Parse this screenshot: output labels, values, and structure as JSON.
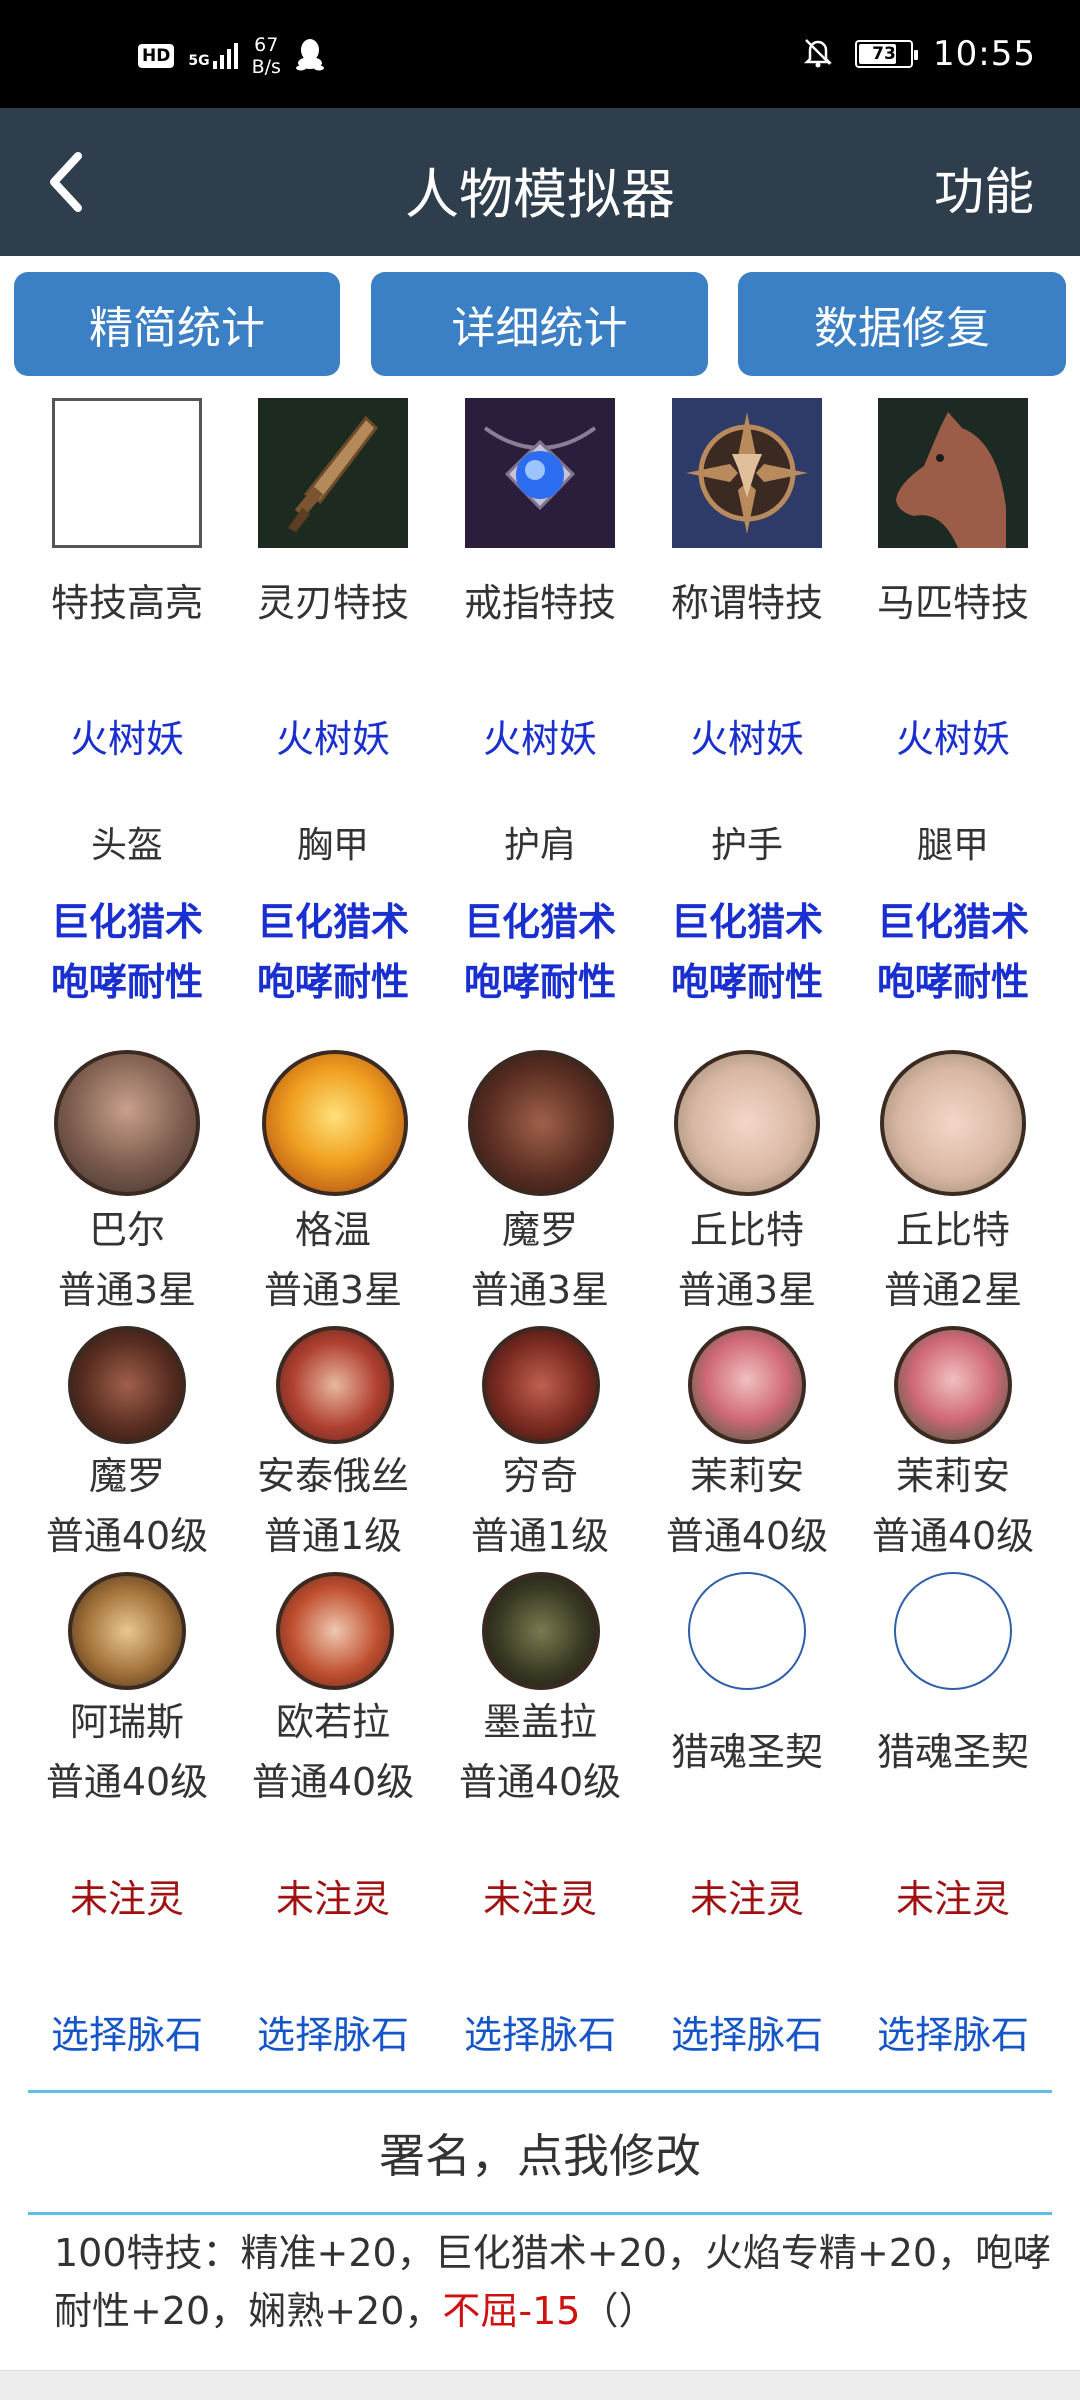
{
  "status_bar": {
    "hd": "HD",
    "network": "5G",
    "speed_value": "67",
    "speed_unit": "B/s",
    "battery": "73",
    "battery_level": 0.73,
    "time": "10:55"
  },
  "app_bar": {
    "title": "人物模拟器",
    "function_label": "功能"
  },
  "top_buttons": [
    "精简统计",
    "详细统计",
    "数据修复"
  ],
  "skills": [
    {
      "label": "特技高亮",
      "icon": "empty-box-icon"
    },
    {
      "label": "灵刃特技",
      "icon": "dagger-icon"
    },
    {
      "label": "戒指特技",
      "icon": "ring-amulet-icon"
    },
    {
      "label": "称谓特技",
      "icon": "emblem-icon"
    },
    {
      "label": "马匹特技",
      "icon": "horse-icon"
    }
  ],
  "set_name": [
    "火树妖",
    "火树妖",
    "火树妖",
    "火树妖",
    "火树妖"
  ],
  "armor": [
    {
      "slot": "头盔",
      "attr1": "巨化猎术",
      "attr2": "咆哮耐性"
    },
    {
      "slot": "胸甲",
      "attr1": "巨化猎术",
      "attr2": "咆哮耐性"
    },
    {
      "slot": "护肩",
      "attr1": "巨化猎术",
      "attr2": "咆哮耐性"
    },
    {
      "slot": "护手",
      "attr1": "巨化猎术",
      "attr2": "咆哮耐性"
    },
    {
      "slot": "腿甲",
      "attr1": "巨化猎术",
      "attr2": "咆哮耐性"
    }
  ],
  "heroes_row1": [
    {
      "name": "巴尔",
      "level": "普通3星"
    },
    {
      "name": "格温",
      "level": "普通3星"
    },
    {
      "name": "魔罗",
      "level": "普通3星"
    },
    {
      "name": "丘比特",
      "level": "普通3星"
    },
    {
      "name": "丘比特",
      "level": "普通2星"
    }
  ],
  "heroes_row2": [
    {
      "name": "魔罗",
      "level": "普通40级"
    },
    {
      "name": "安泰俄丝",
      "level": "普通1级"
    },
    {
      "name": "穷奇",
      "level": "普通1级"
    },
    {
      "name": "茉莉安",
      "level": "普通40级"
    },
    {
      "name": "茉莉安",
      "level": "普通40级"
    }
  ],
  "heroes_row3": [
    {
      "name": "阿瑞斯",
      "level": "普通40级"
    },
    {
      "name": "欧若拉",
      "level": "普通40级"
    },
    {
      "name": "墨盖拉",
      "level": "普通40级"
    },
    {
      "name": "猎魂圣契",
      "level": ""
    },
    {
      "name": "猎魂圣契",
      "level": ""
    }
  ],
  "spirit": [
    "未注灵",
    "未注灵",
    "未注灵",
    "未注灵",
    "未注灵"
  ],
  "vein_stone": [
    "选择脉石",
    "选择脉石",
    "选择脉石",
    "选择脉石",
    "选择脉石"
  ],
  "signature": "署名，点我修改",
  "summary": {
    "text": "100特技：精准+20，巨化猎术+20，火焰专精+20，咆哮耐性+20，娴熟+20，",
    "negative": "不屈-15",
    "suffix": "（）"
  },
  "colors": {
    "app_bar": "#2e3e4c",
    "button": "#3b7fc4",
    "blue_text": "#1a2fd0",
    "red_text": "#a01212",
    "divider": "#62bde6"
  }
}
